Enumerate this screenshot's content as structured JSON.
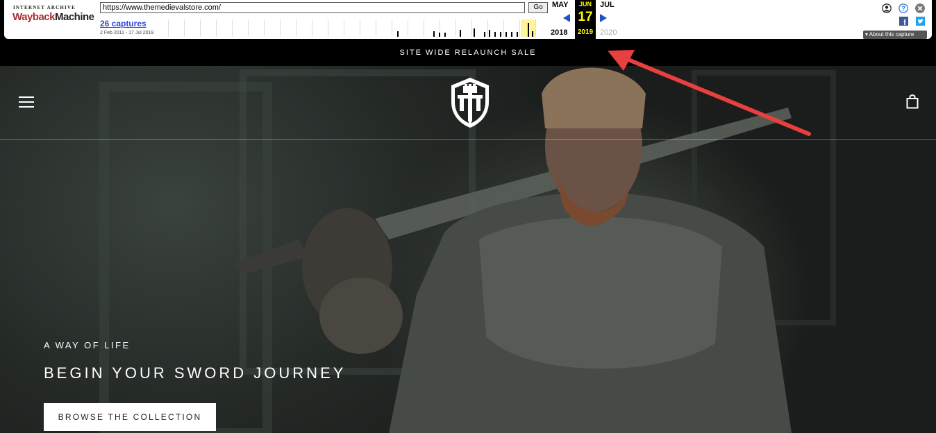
{
  "wayback": {
    "logo_top": "INTERNET ARCHIVE",
    "logo_way": "Wayback",
    "logo_machine": "Machine",
    "url": "https://www.themedievalstore.com/",
    "go_label": "Go",
    "captures_link": "26 captures",
    "date_range": "2 Feb 2011 - 17 Jul 2019",
    "prev_month": "MAY",
    "current_month": "JUN",
    "next_month": "JUL",
    "current_day": "17",
    "prev_year": "2018",
    "current_year": "2019",
    "next_year": "2020",
    "about_label": "About this capture",
    "icons": [
      "user-icon",
      "help-icon",
      "close-icon",
      "facebook-icon",
      "twitter-icon"
    ]
  },
  "announcement": {
    "text": "SITE WIDE RELAUNCH SALE"
  },
  "header": {
    "menu_icon": "hamburger-menu-icon",
    "logo_icon": "shield-castle-sword-logo",
    "cart_icon": "shopping-bag-icon"
  },
  "hero": {
    "eyebrow": "A WAY OF LIFE",
    "headline": "BEGIN YOUR SWORD JOURNEY",
    "cta_label": "BROWSE THE COLLECTION"
  },
  "colors": {
    "toolbar_bg": "#000000",
    "calendar_highlight": "#ffff00",
    "nav_arrow": "#1d52d1",
    "annotation_arrow": "#e8403f",
    "cta_bg": "#ffffff"
  }
}
